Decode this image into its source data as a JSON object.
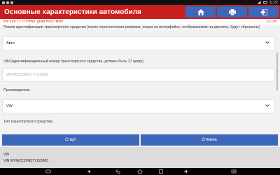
{
  "status_bar": {
    "time": "11:22"
  },
  "header": {
    "title": "Основные характеристики автомобиля",
    "icons": [
      "home-icon",
      "printer-icon",
      "exit-icon"
    ]
  },
  "breadcrumb": {
    "path": "VW V28.77 > ПУНКТ ДИАГНОСТИКИ",
    "voltage": "12.10V"
  },
  "form": {
    "mode_label": "Режим идентификации транспортного средства (после переключения режимов, опции на интерфейсе, отображаемом на дисплее, будут сброшены)",
    "mode_value": "Авто",
    "vin_label": "VIN (идентификационный номер транспортного средства, должен быть 17 цифр)",
    "vin_placeholder": "WVWZZZ9NZ7Y123863",
    "manufacturer_label": "Производитель",
    "manufacturer_value": "VW",
    "vehicle_type_label": "Тип транспортного средства"
  },
  "buttons": {
    "start": "Старт",
    "cancel": "Отмена"
  },
  "info": {
    "line1": "VW",
    "line2": "VIN WVWZZZ9NZ7Y123863"
  },
  "colors": {
    "header": "#c81e1e",
    "button": "#3d68b9"
  }
}
